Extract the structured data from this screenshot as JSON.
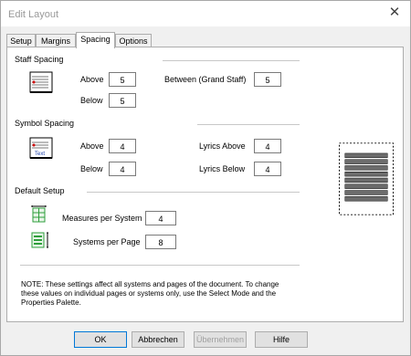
{
  "window": {
    "title": "Edit Layout",
    "close_glyph": "✕"
  },
  "tabs": [
    {
      "label": "Setup"
    },
    {
      "label": "Margins"
    },
    {
      "label": "Spacing",
      "active": true
    },
    {
      "label": "Options"
    }
  ],
  "staff_spacing": {
    "title": "Staff Spacing",
    "above_label": "Above",
    "above_value": "5",
    "below_label": "Below",
    "below_value": "5",
    "between_label": "Between (Grand Staff)",
    "between_value": "5"
  },
  "symbol_spacing": {
    "title": "Symbol Spacing",
    "above_label": "Above",
    "above_value": "4",
    "below_label": "Below",
    "below_value": "4",
    "lyrics_above_label": "Lyrics Above",
    "lyrics_above_value": "4",
    "lyrics_below_label": "Lyrics Below",
    "lyrics_below_value": "4"
  },
  "default_setup": {
    "title": "Default Setup",
    "measures_label": "Measures per System",
    "measures_value": "4",
    "systems_label": "Systems per Page",
    "systems_value": "8"
  },
  "note": "NOTE: These settings affect all systems and pages of the document.  To change these values on individual pages or systems only, use the Select Mode and the Properties Palette.",
  "buttons": {
    "ok": "OK",
    "cancel": "Abbrechen",
    "apply": "Übernehmen",
    "help": "Hilfe"
  },
  "icons": {
    "staff": "staff-spacing-icon",
    "symbol": "symbol-spacing-icon",
    "measures": "measures-per-system-icon",
    "systems": "systems-per-page-icon"
  },
  "colors": {
    "accent": "#0078d7",
    "grid_green": "#2e9e3b"
  }
}
